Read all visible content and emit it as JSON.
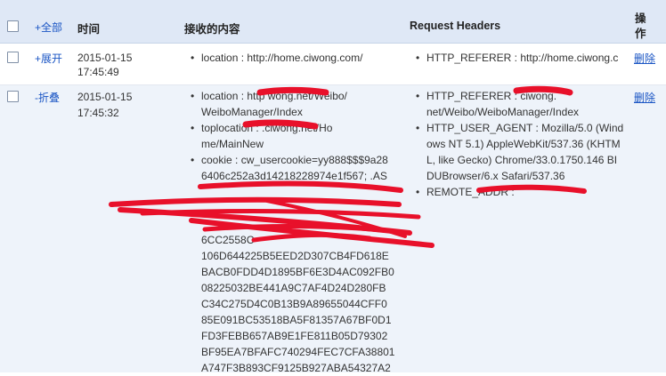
{
  "header": {
    "expand_all": "+全部",
    "time": "时间",
    "received": "接收的内容",
    "request_headers": "Request Headers",
    "operation": "操\n作"
  },
  "rows": [
    {
      "toggle": "+展开",
      "date": "2015-01-15",
      "time": "17:45:49",
      "received": [
        "location : http://home.ciwong.com/"
      ],
      "headers": [
        "HTTP_REFERER : http://home.ciwong.c"
      ],
      "delete": "删除"
    },
    {
      "toggle": "-折叠",
      "date": "2015-01-15",
      "time": "17:45:32",
      "received_lines": [
        "location : http              wong.net/Weibo/",
        "WeiboManager/Index",
        "toplocation :               .ciwong.net/Ho",
        "me/MainNew",
        "cookie : cw_usercookie=yy888$$$9a28",
        "6406c252a3d14218228974e1f567; .AS",
        "",
        "",
        "",
        "6CC2558C                     ",
        "106D644225B5EED2D307CB4FD618E",
        "BACB0FDD4D1895BF6E3D4AC092FB0",
        "08225032BE441A9C7AF4D24D280FB",
        "C34C275D4C0B13B9A89655044CFF0",
        "85E091BC53518BA5F81357A67BF0D1",
        "FD3FEBB657AB9E1FE811B05D79302",
        "BF95EA7BFAFC740294FEC7CFA38801",
        "A747F3B893CF9125B927ABA54327A2"
      ],
      "header_lines": [
        "HTTP_REFERER :                   ciwong.",
        "net/Weibo/WeiboManager/Index",
        "HTTP_USER_AGENT : Mozilla/5.0 (Wind",
        "ows NT 5.1) AppleWebKit/537.36 (KHTM",
        "L, like Gecko) Chrome/33.0.1750.146 BI",
        "DUBrowser/6.x Safari/537.36",
        "REMOTE_ADDR :                  "
      ],
      "delete": "删除"
    }
  ],
  "colors": {
    "header_bg": "#dfe8f6",
    "row_alt_bg": "#eef3fa",
    "link": "#1a55c4",
    "redaction": "#e8102a"
  }
}
